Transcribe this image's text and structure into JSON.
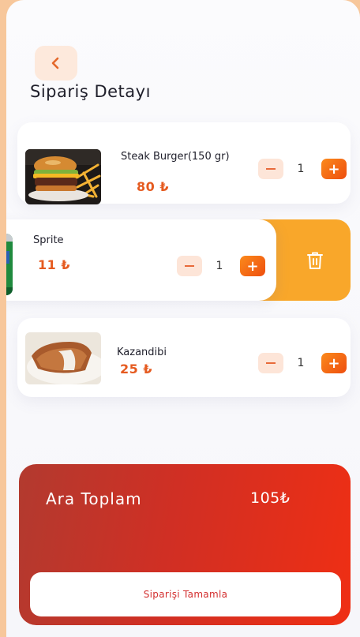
{
  "header": {
    "title": "Sipariş Detayı"
  },
  "items": [
    {
      "name": "Steak Burger(150 gr)",
      "price": "80 ₺",
      "quantity": "1"
    },
    {
      "name": "Sprite",
      "price": "11 ₺",
      "quantity": "1"
    },
    {
      "name": "Kazandibi",
      "price": "25 ₺",
      "quantity": "1"
    }
  ],
  "summary": {
    "label": "Ara Toplam",
    "value": "105₺",
    "button_label": "Siparişi Tamamla"
  },
  "colors": {
    "accent": "#EE4E0E",
    "delete_bg": "#F9A72A",
    "price": "#E55A1F",
    "summary_start": "#B23A2F",
    "summary_end": "#EF2F14"
  }
}
